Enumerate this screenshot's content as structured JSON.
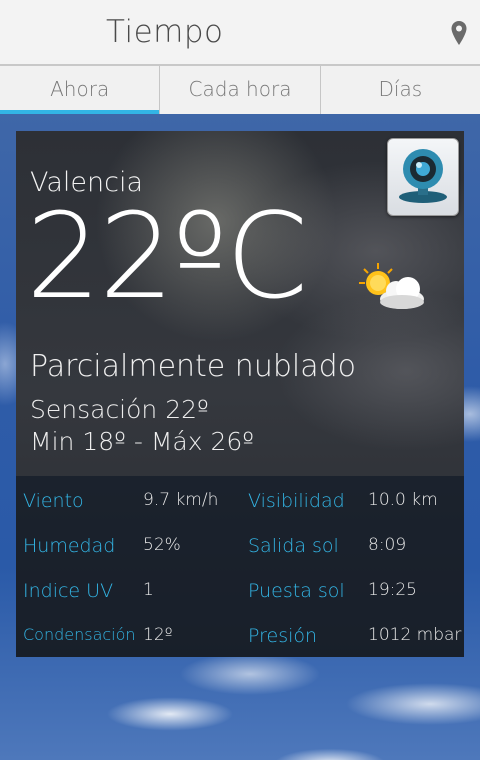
{
  "app": {
    "title": "Tiempo",
    "location_icon": "map-pin-icon"
  },
  "tabs": [
    {
      "label": "Ahora",
      "active": true
    },
    {
      "label": "Cada hora",
      "active": false
    },
    {
      "label": "Días",
      "active": false
    }
  ],
  "current": {
    "city": "Valencia",
    "temperature": "22ºC",
    "condition": "Parcialmente nublado",
    "feels_like": "Sensación 22º",
    "min_max": "Min 18º - Máx 26º",
    "condition_icon": "partly-cloudy-icon",
    "webcam_icon": "webcam-icon"
  },
  "details": {
    "wind": {
      "label": "Viento",
      "value": "9.7 km/h"
    },
    "visibility": {
      "label": "Visibilidad",
      "value": "10.0 km"
    },
    "humidity": {
      "label": "Humedad",
      "value": "52%"
    },
    "sunrise": {
      "label": "Salida sol",
      "value": "8:09"
    },
    "uv": {
      "label": "Indice UV",
      "value": "1"
    },
    "sunset": {
      "label": "Puesta sol",
      "value": "19:25"
    },
    "dew_point": {
      "label": "Condensación",
      "value": "12º"
    },
    "pressure": {
      "label": "Presión",
      "value": "1012 mbar"
    }
  },
  "colors": {
    "accent": "#33b5e5",
    "app_bar": "#f3f3f3"
  }
}
